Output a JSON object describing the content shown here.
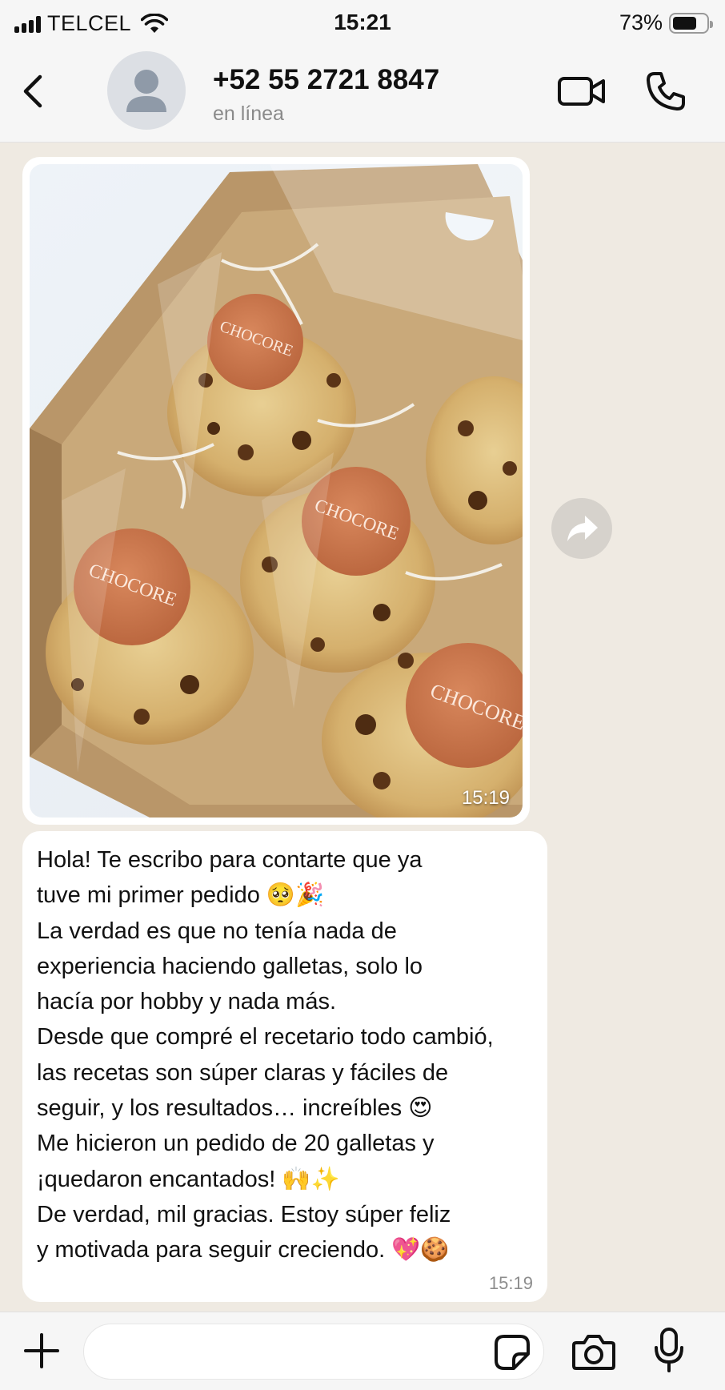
{
  "status_bar": {
    "carrier": "TELCEL",
    "time": "15:21",
    "battery_percent": "73%",
    "battery_level": 0.73,
    "icons": [
      "signal-icon",
      "wifi-icon",
      "battery-icon"
    ]
  },
  "header": {
    "contact_name": "+52 55 2721 8847",
    "contact_status": "en línea",
    "icons": [
      "back-chevron-icon",
      "avatar-placeholder-icon",
      "video-call-icon",
      "phone-icon"
    ]
  },
  "messages": [
    {
      "type": "image",
      "image_label_text": "CHOCORE",
      "time": "15:19"
    },
    {
      "type": "text",
      "text": "Hola! Te escribo para contarte que ya\ntuve mi primer pedido 🥺🎉\nLa verdad es que no tenía nada de\nexperiencia haciendo galletas, solo lo\nhacía por hobby y nada más.\nDesde que compré el recetario todo cambió,\nlas recetas son súper claras y fáciles de\nseguir, y los resultados… increíbles 😍\nMe hicieron un pedido de 20 galletas y\n¡quedaron encantados! 🙌✨\nDe verdad, mil gracias. Estoy súper feliz\ny motivada para seguir creciendo. 💖🍪",
      "time": "15:19"
    }
  ],
  "composer": {
    "input_value": "",
    "icons": [
      "plus-icon",
      "sticker-icon",
      "camera-icon",
      "microphone-icon"
    ]
  },
  "colors": {
    "chat_background": "#efeae2",
    "bubble_incoming": "#ffffff",
    "bar_background": "#f6f6f6",
    "muted_text": "#8a8a8a"
  }
}
